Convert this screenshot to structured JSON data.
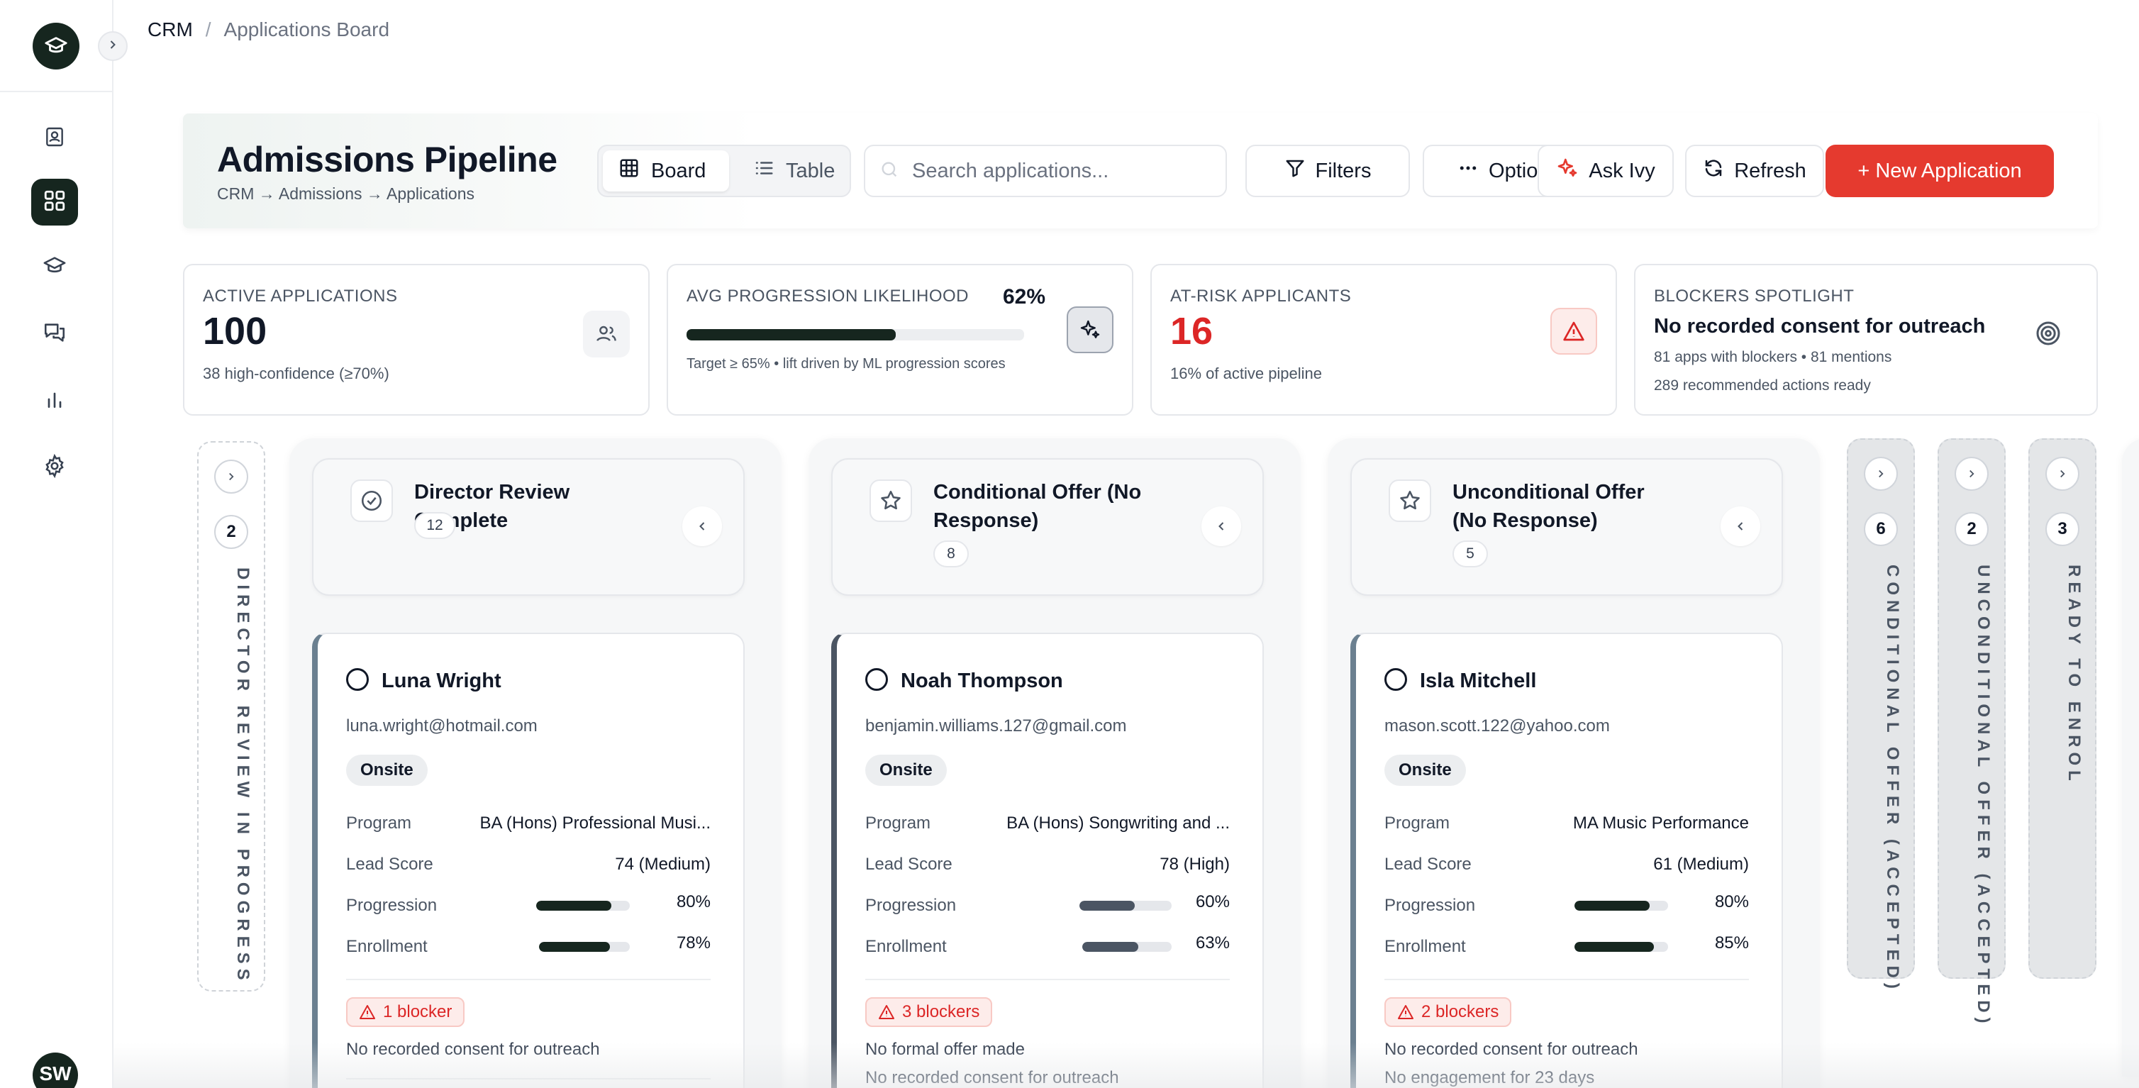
{
  "nav": {
    "breadcrumb": [
      "CRM",
      "Applications Board"
    ],
    "separator": "/",
    "avatar_initials": "SW",
    "items": [
      {
        "icon": "contact-book-icon"
      },
      {
        "icon": "board-grid-icon",
        "active": true
      },
      {
        "icon": "graduation-cap-icon"
      },
      {
        "icon": "chat-bubbles-icon"
      },
      {
        "icon": "bar-chart-icon"
      },
      {
        "icon": "gear-icon"
      }
    ]
  },
  "header": {
    "title": "Admissions Pipeline",
    "subtitle": "CRM → Admissions → Applications",
    "view_toggle": {
      "board": "Board",
      "table": "Table",
      "selected": "Board"
    },
    "search_placeholder": "Search applications...",
    "buttons": {
      "filters": "Filters",
      "options": "Options",
      "ask_ivy": "Ask Ivy",
      "refresh": "Refresh",
      "new_application": "+ New Application"
    }
  },
  "stats": {
    "active": {
      "label": "ACTIVE APPLICATIONS",
      "value": "100",
      "note": "38 high-confidence (≥70%)"
    },
    "progression": {
      "label": "AVG PROGRESSION LIKELIHOOD",
      "value": "62%",
      "progress": 0.62,
      "note": "Target ≥ 65% • lift driven by ML progression scores"
    },
    "at_risk": {
      "label": "AT-RISK APPLICANTS",
      "value": "16",
      "note": "16% of active pipeline"
    },
    "blockers": {
      "label": "BLOCKERS SPOTLIGHT",
      "headline": "No recorded consent for outreach",
      "note1": "81 apps with blockers • 81 mentions",
      "note2": "289 recommended actions ready"
    }
  },
  "board": {
    "collapsed_left": {
      "count": "2",
      "label": "DIRECTOR REVIEW IN PROGRESS"
    },
    "columns": [
      {
        "title": "Director Review Complete",
        "count": "12",
        "icon": "check-circle-icon",
        "card": {
          "name": "Luna Wright",
          "email": "luna.wright@hotmail.com",
          "mode": "Onsite",
          "program_label": "Program",
          "program": "BA (Hons) Professional Musi...",
          "lead_label": "Lead Score",
          "lead": "74 (Medium)",
          "progression_label": "Progression",
          "progression": "80%",
          "progression_value": 0.8,
          "enrollment_label": "Enrollment",
          "enrollment": "78%",
          "enrollment_value": 0.78,
          "bar_color": "#16261f",
          "blockers": "1 blocker",
          "reasons": [
            "No recorded consent for outreach"
          ]
        }
      },
      {
        "title": "Conditional Offer (No Response)",
        "count": "8",
        "icon": "star-icon",
        "card": {
          "name": "Noah Thompson",
          "email": "benjamin.williams.127@gmail.com",
          "mode": "Onsite",
          "program_label": "Program",
          "program": "BA (Hons) Songwriting and ...",
          "lead_label": "Lead Score",
          "lead": "78 (High)",
          "progression_label": "Progression",
          "progression": "60%",
          "progression_value": 0.6,
          "enrollment_label": "Enrollment",
          "enrollment": "63%",
          "enrollment_value": 0.63,
          "bar_color": "#4b5563",
          "blockers": "3 blockers",
          "reasons": [
            "No formal offer made",
            "No recorded consent for outreach"
          ]
        }
      },
      {
        "title": "Unconditional Offer (No Response)",
        "count": "5",
        "icon": "star-icon",
        "card": {
          "name": "Isla Mitchell",
          "email": "mason.scott.122@yahoo.com",
          "mode": "Onsite",
          "program_label": "Program",
          "program": "MA Music Performance",
          "lead_label": "Lead Score",
          "lead": "61 (Medium)",
          "progression_label": "Progression",
          "progression": "80%",
          "progression_value": 0.8,
          "enrollment_label": "Enrollment",
          "enrollment": "85%",
          "enrollment_value": 0.85,
          "bar_color": "#16261f",
          "blockers": "2 blockers",
          "reasons": [
            "No recorded consent for outreach",
            "No engagement for 23 days"
          ]
        }
      }
    ],
    "collapsed_right": [
      {
        "count": "6",
        "label": "CONDITIONAL OFFER (ACCEPTED)"
      },
      {
        "count": "2",
        "label": "UNCONDITIONAL OFFER (ACCEPTED)"
      },
      {
        "count": "3",
        "label": "READY TO ENROL"
      }
    ]
  },
  "colors": {
    "accent": "#e53a2f",
    "dark": "#16261f",
    "danger": "#dc2626"
  }
}
